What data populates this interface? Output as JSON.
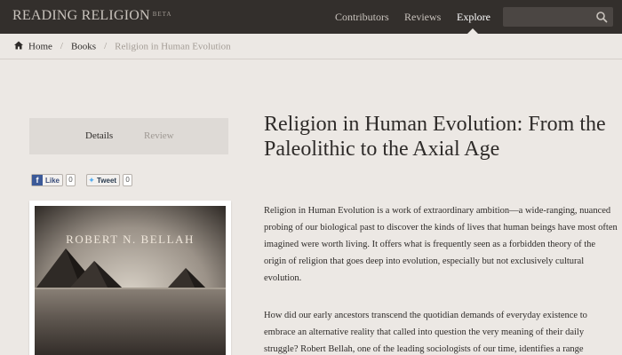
{
  "brand": {
    "name": "READING RELIGION",
    "badge": "BETA"
  },
  "nav": {
    "items": [
      {
        "label": "Contributors",
        "active": false
      },
      {
        "label": "Reviews",
        "active": false
      },
      {
        "label": "Explore",
        "active": true
      }
    ]
  },
  "search": {
    "value": "",
    "placeholder": "",
    "icon": "search-icon"
  },
  "breadcrumb": {
    "home_icon": "home-icon",
    "items": [
      "Home",
      "Books",
      "Religion in Human Evolution"
    ]
  },
  "tabs": {
    "details": "Details",
    "review": "Review"
  },
  "social": {
    "like_label": "Like",
    "like_count": "0",
    "tweet_label": "Tweet",
    "tweet_count": "0"
  },
  "cover": {
    "author": "ROBERT N. BELLAH"
  },
  "book": {
    "title": "Religion in Human Evolution: From the Paleolithic to the Axial Age",
    "paragraph1": "Religion in Human Evolution is a work of extraordinary ambition—a wide-ranging, nuanced probing of our biological past to discover the kinds of lives that human beings have most often imagined were worth living. It offers what is frequently seen as a forbidden theory of the origin of religion that goes deep into evolution, especially but not exclusively cultural evolution.",
    "paragraph2": "How did our early ancestors transcend the quotidian demands of everyday existence to embrace an alternative reality that called into question the very meaning of their daily struggle? Robert Bellah, one of the leading sociologists of our time, identifies a range"
  },
  "colors": {
    "topbar": "#332f2c",
    "page_bg": "#ece8e4",
    "tab_bg": "#dedad6",
    "muted_text": "#a39c95"
  }
}
